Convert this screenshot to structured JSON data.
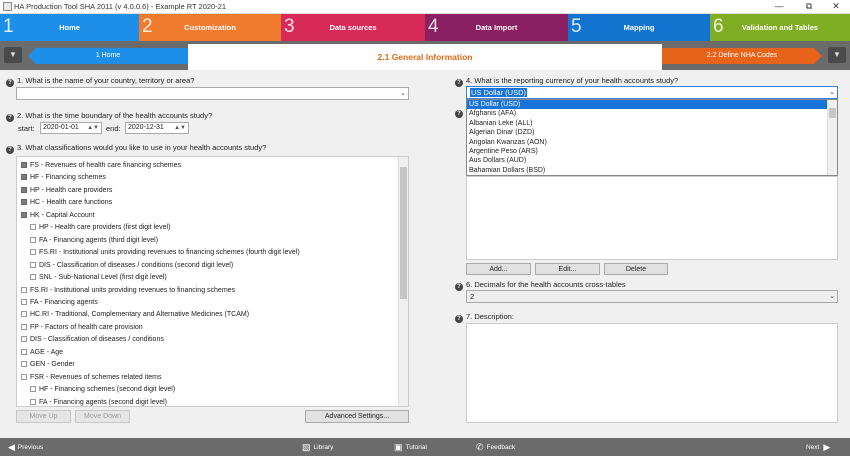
{
  "window": {
    "title": "HA Production Tool SHA 2011 (v 4.0.0.6) - Example RT 2020-21"
  },
  "steps": [
    {
      "num": "1",
      "label": "Home",
      "color": "#1e8fe8"
    },
    {
      "num": "2",
      "label": "Customization",
      "color": "#f07a2e"
    },
    {
      "num": "3",
      "label": "Data sources",
      "color": "#d82a56"
    },
    {
      "num": "4",
      "label": "Data Import",
      "color": "#8a1f62"
    },
    {
      "num": "5",
      "label": "Mapping",
      "color": "#1374d0"
    },
    {
      "num": "6",
      "label": "Validation and Tables",
      "color": "#7fad24"
    }
  ],
  "subnav": {
    "prev": "1 Home",
    "current": "2.1 General Information",
    "next": "2.2 Define NHA Codes",
    "current_color": "#e06a1a"
  },
  "q1": {
    "label": "1. What is the name of your country, territory or area?",
    "value": ""
  },
  "q2": {
    "label": "2. What is the time boundary of the health accounts study?",
    "start_label": "start:",
    "start": "2020-01-01",
    "end_label": "end:",
    "end": "2020-12-31"
  },
  "q3": {
    "label": "3. What classifications would you like to use in your health accounts study?",
    "items": [
      {
        "text": "FS - Revenues of health care financing schemes",
        "level": 0,
        "checked": true
      },
      {
        "text": "HF - Financing schemes",
        "level": 0,
        "checked": true
      },
      {
        "text": "HP - Health care providers",
        "level": 0,
        "checked": true
      },
      {
        "text": "HC - Health care functions",
        "level": 0,
        "checked": true
      },
      {
        "text": "HK - Capital Account",
        "level": 0,
        "checked": true
      },
      {
        "text": "HP - Health care providers (first digit level)",
        "level": 1,
        "checked": false
      },
      {
        "text": "FA - Financing agents (third digit level)",
        "level": 1,
        "checked": false
      },
      {
        "text": "FS.RI - Institutional units providing revenues to financing schemes (fourth digit level)",
        "level": 1,
        "checked": false
      },
      {
        "text": "DIS - Classification of diseases / conditions (second digit level)",
        "level": 1,
        "checked": false
      },
      {
        "text": "SNL - Sub-National Level (first digit level)",
        "level": 1,
        "checked": false
      },
      {
        "text": "FS.RI - Institutional units providing revenues to financing schemes",
        "level": 0,
        "checked": false
      },
      {
        "text": "FA - Financing agents",
        "level": 0,
        "checked": false
      },
      {
        "text": "HC.RI - Traditional, Complementary and Alternative Medicines (TCAM)",
        "level": 0,
        "checked": false
      },
      {
        "text": "FP - Factors of health care provision",
        "level": 0,
        "checked": false
      },
      {
        "text": "DIS - Classification of diseases / conditions",
        "level": 0,
        "checked": false
      },
      {
        "text": "AGE - Age",
        "level": 0,
        "checked": false
      },
      {
        "text": "GEN - Gender",
        "level": 0,
        "checked": false
      },
      {
        "text": "FSR - Revenues of schemes related items",
        "level": 0,
        "checked": false
      },
      {
        "text": "HF - Financing schemes (second digit level)",
        "level": 1,
        "checked": false
      },
      {
        "text": "FA - Financing agents (second digit level)",
        "level": 1,
        "checked": false
      }
    ],
    "move_up": "Move Up",
    "move_down": "Move Down",
    "advanced": "Advanced Settings..."
  },
  "q4": {
    "label": "4. What is the reporting currency of your health accounts study?",
    "value": "US Dollar (USD)",
    "options": [
      "US Dollar (USD)",
      "Afghanis (AFA)",
      "Albanian Leke (ALL)",
      "Algerian Dinar (DZD)",
      "Angolan Kwanzas (AON)",
      "Argentine Peso (ARS)",
      "Aus Dollars (AUD)",
      "Bahamian Dollars (BSD)"
    ],
    "add": "Add...",
    "edit": "Edit...",
    "delete": "Delete"
  },
  "q6": {
    "label": "6. Decimals for the health accounts cross-tables",
    "value": "2"
  },
  "q7": {
    "label": "7. Description:",
    "value": ""
  },
  "bottom": {
    "previous": "Previous",
    "library": "Library",
    "tutorial": "Tutorial",
    "feedback": "Feedback",
    "next": "Next"
  }
}
